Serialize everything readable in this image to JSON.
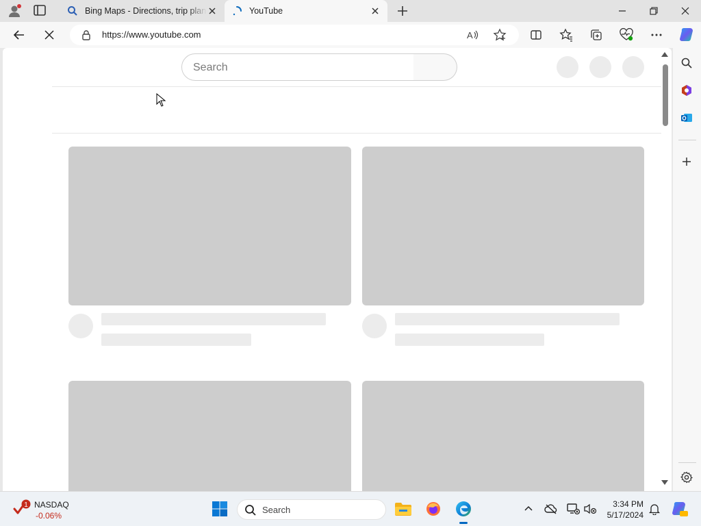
{
  "browser": {
    "tabs": [
      {
        "title": "Bing Maps - Directions, trip planning",
        "active": false,
        "icon": "search-icon"
      },
      {
        "title": "YouTube",
        "active": true,
        "icon": "loading-spinner-icon"
      }
    ],
    "address": {
      "url": "https://www.youtube.com"
    },
    "icons": {
      "profile": "profile-icon",
      "tab_actions": "tab-actions-icon",
      "new_tab": "plus-icon",
      "minimize": "minimize-icon",
      "restore": "restore-icon",
      "close": "close-icon",
      "back": "back-arrow-icon",
      "stop": "stop-loading-icon",
      "read_aloud": "read-aloud-icon",
      "favorite": "star-icon",
      "split_screen": "split-screen-icon",
      "favorites": "favorites-icon",
      "collections": "collections-icon",
      "browser_essentials": "heart-pulse-icon",
      "more": "more-icon",
      "copilot": "copilot-icon"
    }
  },
  "page": {
    "search_placeholder": "Search"
  },
  "sidebar": {
    "items": [
      "search-icon",
      "office-icon",
      "outlook-icon",
      "add-icon",
      "settings-icon"
    ]
  },
  "taskbar": {
    "widget": {
      "name": "NASDAQ",
      "change": "-0.06%",
      "badge": "1"
    },
    "search_label": "Search",
    "time": "3:34 PM",
    "date": "5/17/2024",
    "colors": {
      "accent": "#0067c0",
      "negative": "#c42b1c"
    }
  }
}
